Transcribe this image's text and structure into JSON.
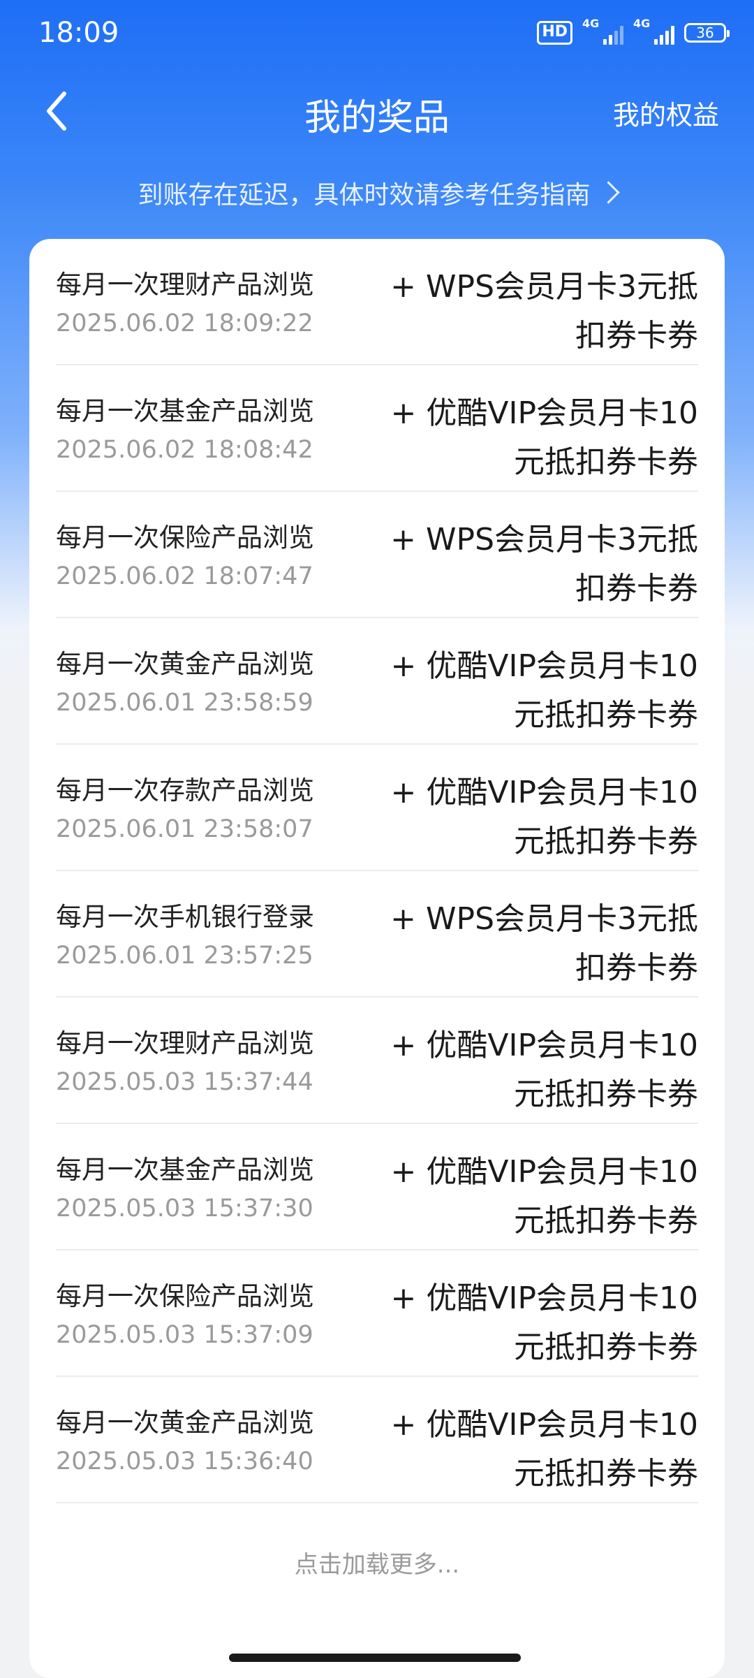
{
  "status_bar": {
    "time": "18:09",
    "hd": "HD",
    "net1": "4G",
    "net2": "4G",
    "battery": "36"
  },
  "nav": {
    "title": "我的奖品",
    "right_link": "我的权益"
  },
  "notice": "到账存在延迟，具体时效请参考任务指南",
  "rewards": [
    {
      "task": "每月一次理财产品浏览",
      "time": "2025.06.02 18:09:22",
      "prize": "+ WPS会员月卡3元抵扣券卡券"
    },
    {
      "task": "每月一次基金产品浏览",
      "time": "2025.06.02 18:08:42",
      "prize": "+ 优酷VIP会员月卡10元抵扣券卡券"
    },
    {
      "task": "每月一次保险产品浏览",
      "time": "2025.06.02 18:07:47",
      "prize": "+ WPS会员月卡3元抵扣券卡券"
    },
    {
      "task": "每月一次黄金产品浏览",
      "time": "2025.06.01 23:58:59",
      "prize": "+ 优酷VIP会员月卡10元抵扣券卡券"
    },
    {
      "task": "每月一次存款产品浏览",
      "time": "2025.06.01 23:58:07",
      "prize": "+ 优酷VIP会员月卡10元抵扣券卡券"
    },
    {
      "task": "每月一次手机银行登录",
      "time": "2025.06.01 23:57:25",
      "prize": "+ WPS会员月卡3元抵扣券卡券"
    },
    {
      "task": "每月一次理财产品浏览",
      "time": "2025.05.03 15:37:44",
      "prize": "+ 优酷VIP会员月卡10元抵扣券卡券"
    },
    {
      "task": "每月一次基金产品浏览",
      "time": "2025.05.03 15:37:30",
      "prize": "+ 优酷VIP会员月卡10元抵扣券卡券"
    },
    {
      "task": "每月一次保险产品浏览",
      "time": "2025.05.03 15:37:09",
      "prize": "+ 优酷VIP会员月卡10元抵扣券卡券"
    },
    {
      "task": "每月一次黄金产品浏览",
      "time": "2025.05.03 15:36:40",
      "prize": "+ 优酷VIP会员月卡10元抵扣券卡券"
    }
  ],
  "load_more": "点击加载更多..."
}
